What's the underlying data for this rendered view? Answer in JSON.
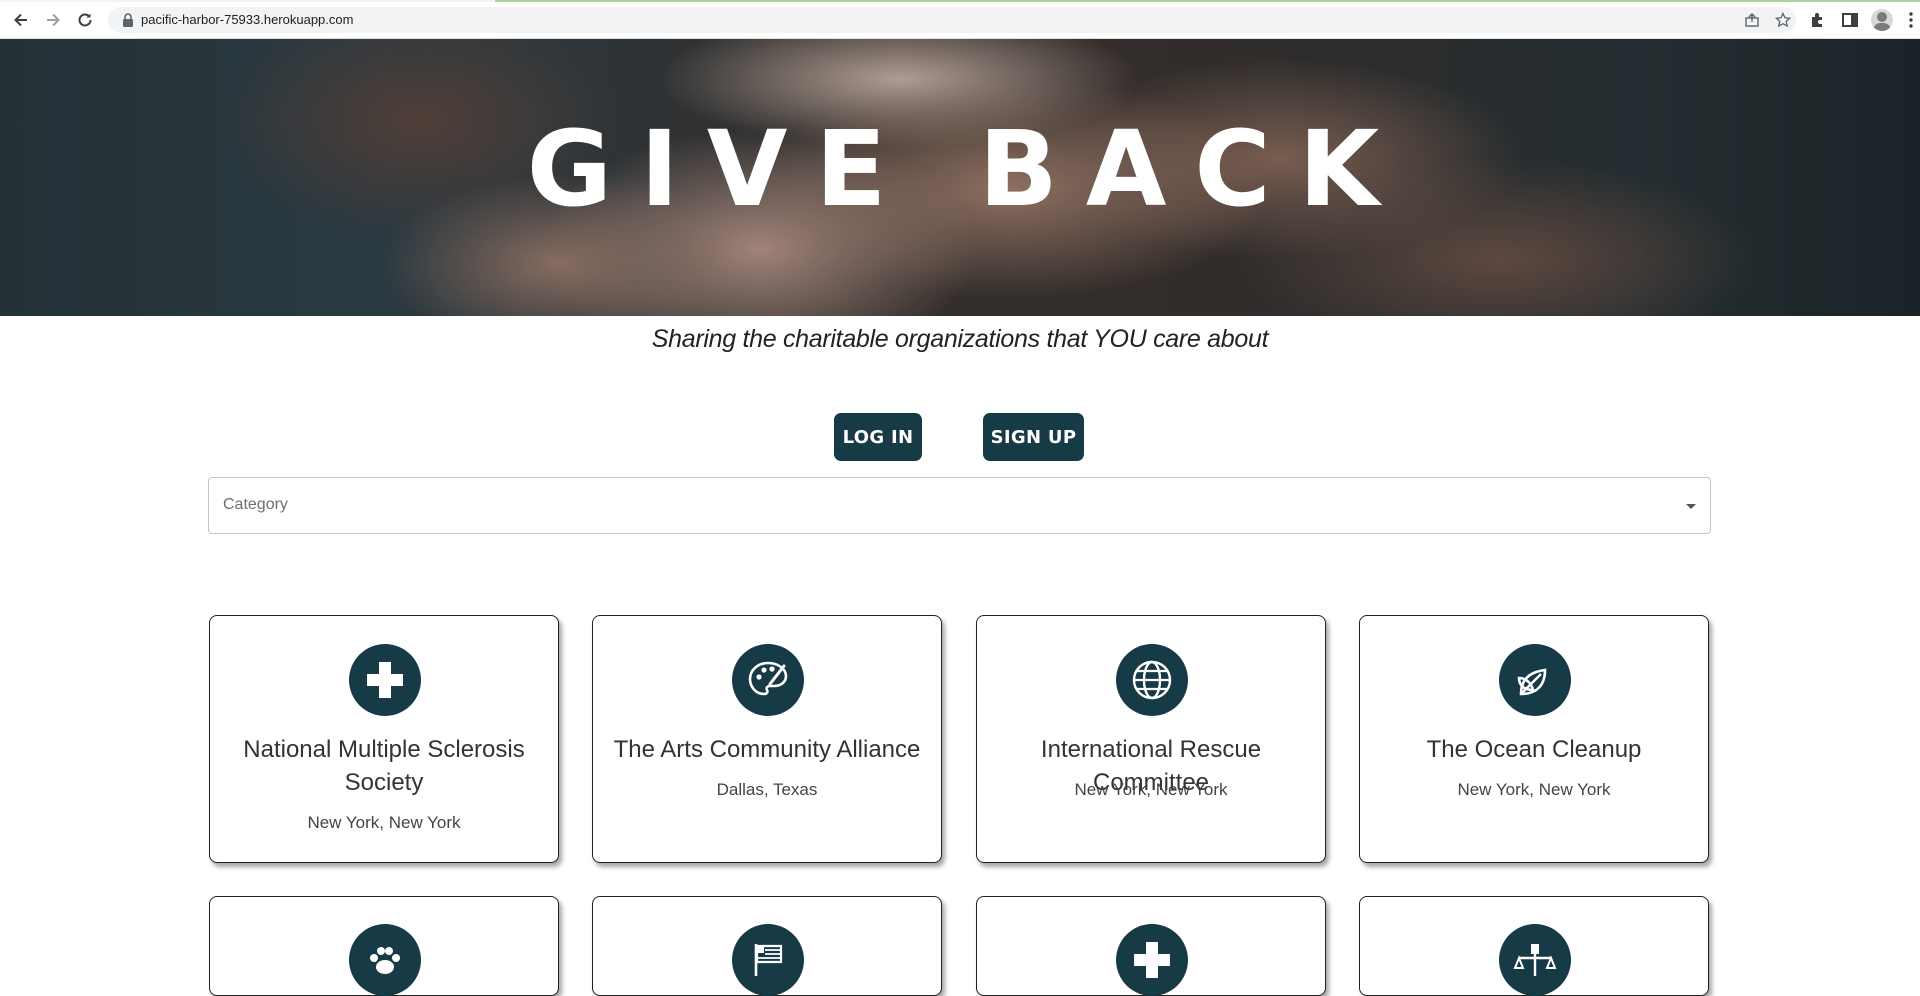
{
  "browser": {
    "url": "pacific-harbor-75933.herokuapp.com"
  },
  "hero": {
    "title": "GIVE BACK"
  },
  "tagline": "Sharing the charitable organizations that YOU care about",
  "auth": {
    "login_label": "LOG IN",
    "signup_label": "SIGN UP"
  },
  "filter": {
    "category_placeholder": "Category"
  },
  "organizations": [
    {
      "name": "National Multiple Sclerosis Society",
      "location": "New York, New York",
      "icon": "medical-cross-icon"
    },
    {
      "name": "The Arts Community Alliance",
      "location": "Dallas, Texas",
      "icon": "palette-icon"
    },
    {
      "name": "International Rescue Committee",
      "location": "New York, New York",
      "icon": "globe-icon"
    },
    {
      "name": "The Ocean Cleanup",
      "location": "New York, New York",
      "icon": "leaf-icon"
    }
  ],
  "organizations_partial": [
    {
      "icon": "paw-icon"
    },
    {
      "icon": "flag-icon"
    },
    {
      "icon": "medical-cross-icon"
    },
    {
      "icon": "justice-icon"
    }
  ],
  "colors": {
    "brand": "#173a47"
  }
}
